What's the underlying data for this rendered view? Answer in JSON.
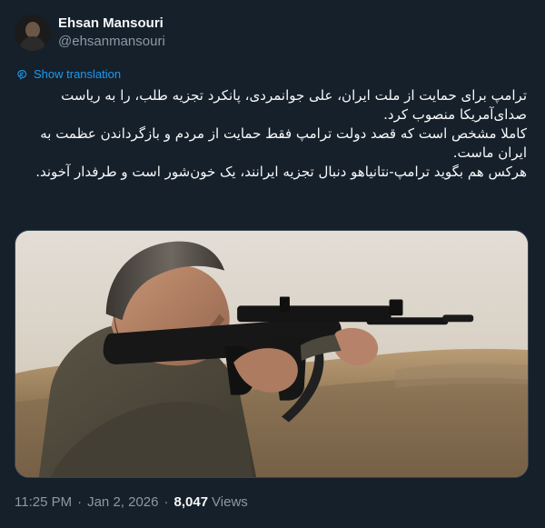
{
  "author": {
    "display_name": "Ehsan Mansouri",
    "handle": "@ehsanmansouri"
  },
  "translate": {
    "label": "Show translation",
    "icon": "translate-icon"
  },
  "tweet": {
    "paragraphs": [
      "ترامپ برای حمایت از ملت ایران، علی جوانمردی، پانکرد تجزیه طلب، را به ریاست صدای‌آمریکا منصوب کرد.",
      "کاملا مشخص است که قصد دولت ترامپ فقط حمایت از مردم و بازگرداندن عظمت به ایران ماست.",
      "هرکس هم بگوید ترامپ-نتانیاهو دنبال تجزیه ایرانند، یک خون‌شور است و طرفدار آخوند."
    ]
  },
  "meta": {
    "time": "11:25 PM",
    "separator": "·",
    "date": "Jan 2, 2026",
    "views_count": "8,047",
    "views_label": "Views"
  },
  "colors": {
    "background": "#15202b",
    "text": "#f7f9f9",
    "secondary": "#8b98a5",
    "accent": "#1d9bf0",
    "border": "#38444d"
  }
}
